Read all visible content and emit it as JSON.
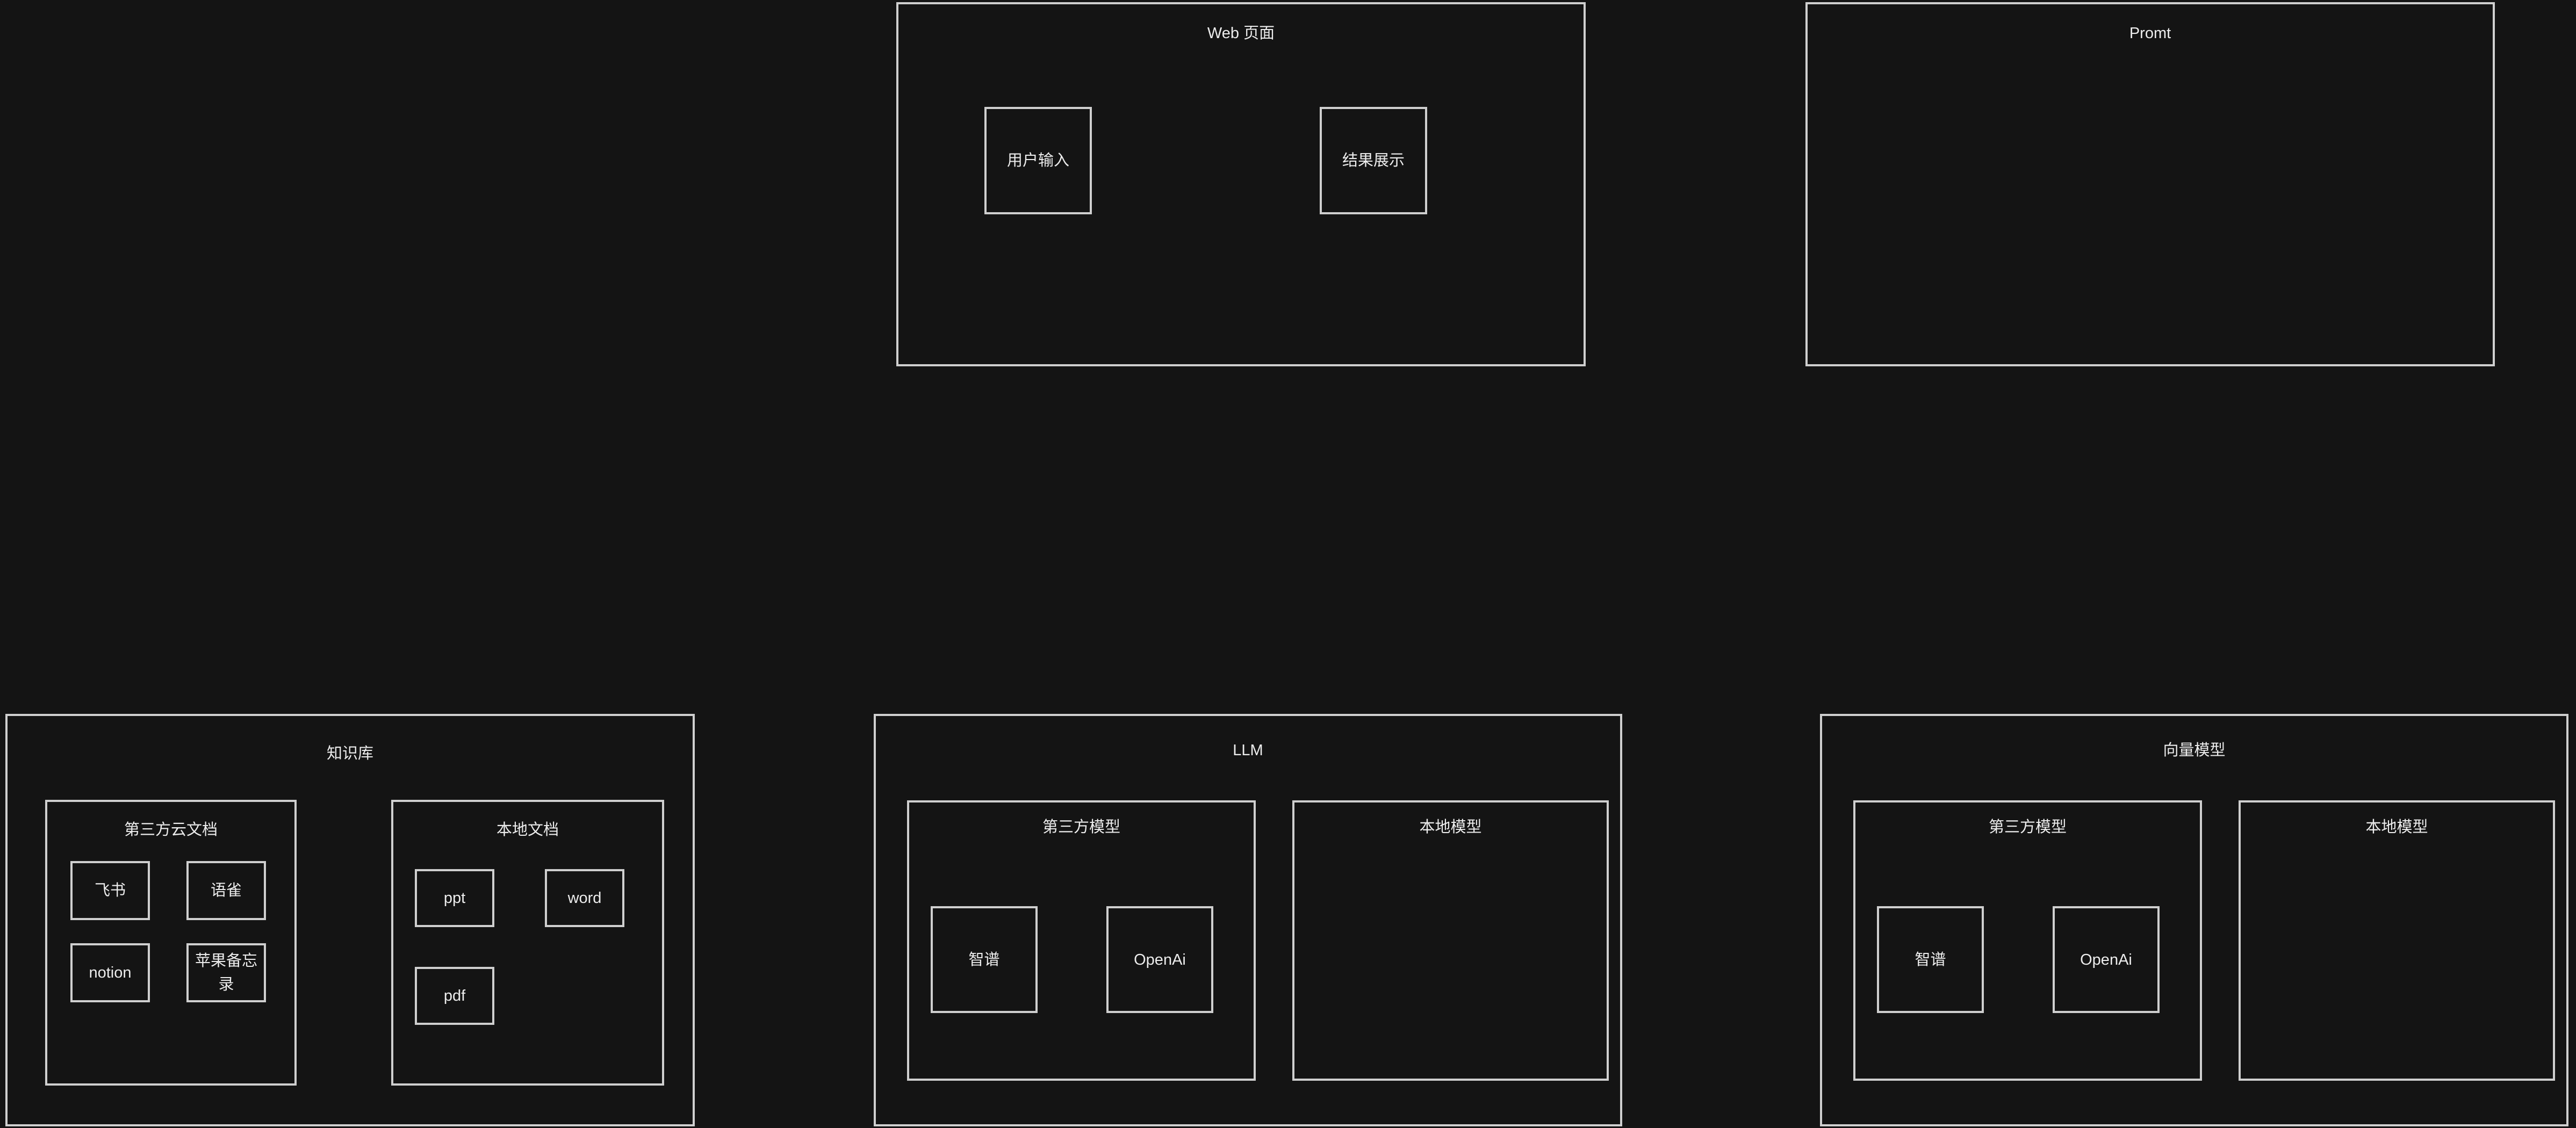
{
  "web": {
    "title": "Web 页面",
    "user_input": "用户输入",
    "result_display": "结果展示"
  },
  "promt": {
    "title": "Promt"
  },
  "knowledge": {
    "title": "知识库",
    "cloud": {
      "title": "第三方云文档",
      "feishu": "飞书",
      "yuque": "语雀",
      "notion": "notion",
      "apple_notes": "苹果备忘录"
    },
    "local": {
      "title": "本地文档",
      "ppt": "ppt",
      "word": "word",
      "pdf": "pdf"
    }
  },
  "llm": {
    "title": "LLM",
    "third_party": {
      "title": "第三方模型",
      "zhipu": "智谱",
      "openai": "OpenAi"
    },
    "local": {
      "title": "本地模型"
    }
  },
  "vector": {
    "title": "向量模型",
    "third_party": {
      "title": "第三方模型",
      "zhipu": "智谱",
      "openai": "OpenAi"
    },
    "local": {
      "title": "本地模型"
    }
  }
}
